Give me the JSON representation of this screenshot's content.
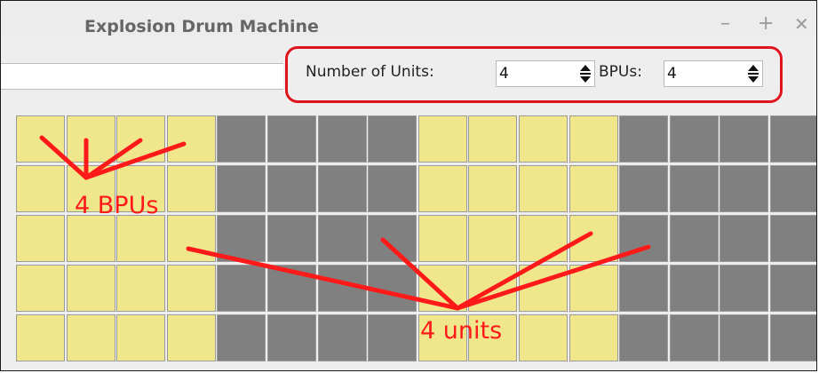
{
  "window": {
    "title": "Explosion Drum Machine",
    "minimize_glyph": "–",
    "maximize_glyph": "+",
    "close_glyph": "✕"
  },
  "controls": {
    "units_label": "Number of Units:",
    "units_value": "4",
    "bpus_label": "BPUs:",
    "bpus_value": "4"
  },
  "grid": {
    "rows": 5,
    "columns": 16,
    "beats_per_unit": 4,
    "unit_colors": [
      "#f0e68c",
      "#808080"
    ]
  },
  "annotations": {
    "bpus_text": "4 BPUs",
    "units_text": "4 units",
    "color": "#ff1a1a"
  }
}
